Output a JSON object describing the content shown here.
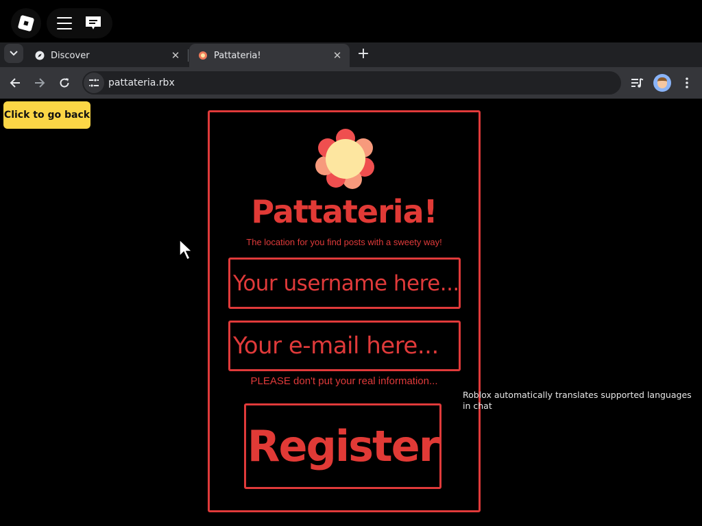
{
  "roblox_overlay": {
    "logo_icon": "roblox-logo-icon",
    "menu_icon": "hamburger-menu-icon",
    "chat_icon": "chat-bubble-icon"
  },
  "browser": {
    "tabs": [
      {
        "title": "Discover",
        "icon": "compass-icon",
        "active": false
      },
      {
        "title": "Pattateria!",
        "icon": "flower-favicon",
        "active": true
      }
    ],
    "address_bar": {
      "url": "pattateria.rbx"
    },
    "toolbar_icons": [
      "back-arrow-icon",
      "forward-arrow-icon",
      "reload-icon",
      "site-settings-icon",
      "media-queue-icon",
      "profile-avatar",
      "more-vert-icon"
    ]
  },
  "page": {
    "back_button_label": "Click to go back",
    "title": "Pattateria!",
    "subtitle": "The location for you find posts with a sweety way!",
    "username_placeholder": "Your username here...",
    "email_placeholder": "Your e-mail here...",
    "warning": "PLEASE don't put your real information...",
    "register_label": "Register",
    "accent_color": "#e03a3a",
    "back_button_color": "#fbd646"
  },
  "notification": {
    "text": "Roblox automatically translates supported languages in chat"
  }
}
